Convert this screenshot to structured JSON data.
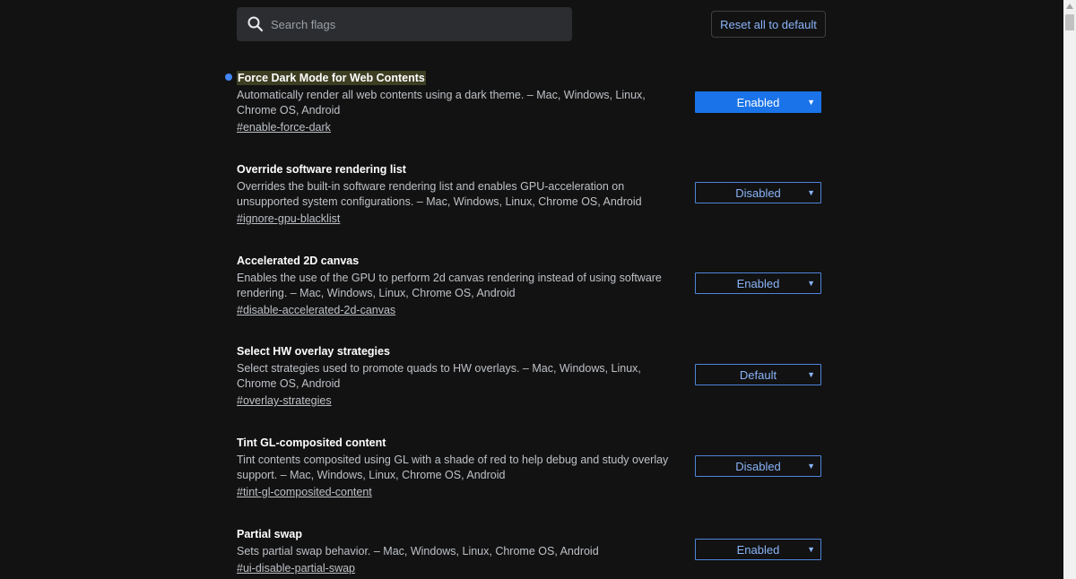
{
  "search": {
    "placeholder": "Search flags",
    "icon": "search-icon"
  },
  "reset_label": "Reset all to default",
  "experiments": [
    {
      "title": "Force Dark Mode for Web Contents",
      "description": "Automatically render all web contents using a dark theme. – Mac, Windows, Linux, Chrome OS, Android",
      "link": "#enable-force-dark",
      "value": "Enabled",
      "modified": true
    },
    {
      "title": "Override software rendering list",
      "description": "Overrides the built-in software rendering list and enables GPU-acceleration on unsupported system configurations. – Mac, Windows, Linux, Chrome OS, Android",
      "link": "#ignore-gpu-blacklist",
      "value": "Disabled",
      "modified": false
    },
    {
      "title": "Accelerated 2D canvas",
      "description": "Enables the use of the GPU to perform 2d canvas rendering instead of using software rendering. – Mac, Windows, Linux, Chrome OS, Android",
      "link": "#disable-accelerated-2d-canvas",
      "value": "Enabled",
      "modified": false
    },
    {
      "title": "Select HW overlay strategies",
      "description": "Select strategies used to promote quads to HW overlays. – Mac, Windows, Linux, Chrome OS, Android",
      "link": "#overlay-strategies",
      "value": "Default",
      "modified": false
    },
    {
      "title": "Tint GL-composited content",
      "description": "Tint contents composited using GL with a shade of red to help debug and study overlay support. – Mac, Windows, Linux, Chrome OS, Android",
      "link": "#tint-gl-composited-content",
      "value": "Disabled",
      "modified": false
    },
    {
      "title": "Partial swap",
      "description": "Sets partial swap behavior. – Mac, Windows, Linux, Chrome OS, Android",
      "link": "#ui-disable-partial-swap",
      "value": "Enabled",
      "modified": false
    }
  ],
  "colors": {
    "background": "#121212",
    "accent": "#1a73e8",
    "link_blue": "#8ab4f8",
    "modified_dot": "#4285f4"
  }
}
